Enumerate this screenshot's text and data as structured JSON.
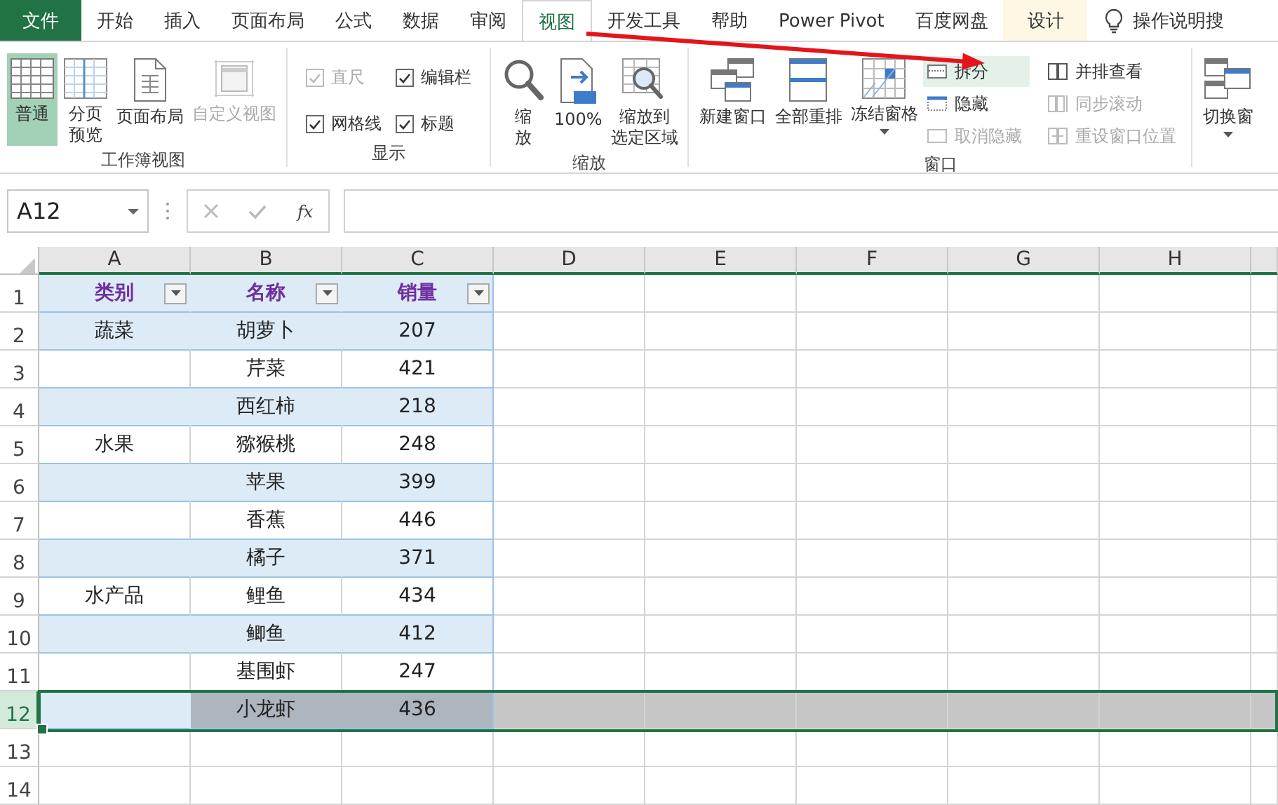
{
  "ribbon_tabs": [
    {
      "label": "文件",
      "kind": "file",
      "selected": false
    },
    {
      "label": "开始",
      "kind": "tab",
      "selected": false
    },
    {
      "label": "插入",
      "kind": "tab",
      "selected": false
    },
    {
      "label": "页面布局",
      "kind": "tab",
      "selected": false
    },
    {
      "label": "公式",
      "kind": "tab",
      "selected": false
    },
    {
      "label": "数据",
      "kind": "tab",
      "selected": false
    },
    {
      "label": "审阅",
      "kind": "tab",
      "selected": false
    },
    {
      "label": "视图",
      "kind": "tab",
      "selected": true
    },
    {
      "label": "开发工具",
      "kind": "tab",
      "selected": false
    },
    {
      "label": "帮助",
      "kind": "tab",
      "selected": false
    },
    {
      "label": "Power Pivot",
      "kind": "tab",
      "selected": false
    },
    {
      "label": "百度网盘",
      "kind": "tab",
      "selected": false
    },
    {
      "label": "设计",
      "kind": "context",
      "selected": false
    }
  ],
  "tell_me": {
    "label": "操作说明搜"
  },
  "ribbon_groups": [
    {
      "title": "工作簿视图",
      "items": [
        {
          "kind": "large",
          "lines": [
            "普通"
          ],
          "selected": true,
          "disabled": false
        },
        {
          "kind": "large",
          "lines": [
            "分页",
            "预览"
          ],
          "selected": false,
          "disabled": false
        },
        {
          "kind": "large",
          "lines": [
            "页面布局"
          ],
          "selected": false,
          "disabled": false
        },
        {
          "kind": "large",
          "lines": [
            "自定义视图"
          ],
          "selected": false,
          "disabled": true
        }
      ]
    },
    {
      "title": "显示",
      "items": [
        {
          "kind": "check",
          "label": "直尺",
          "checked": true,
          "disabled": true
        },
        {
          "kind": "check",
          "label": "编辑栏",
          "checked": true,
          "disabled": false
        },
        {
          "kind": "check",
          "label": "网格线",
          "checked": true,
          "disabled": false
        },
        {
          "kind": "check",
          "label": "标题",
          "checked": true,
          "disabled": false
        }
      ]
    },
    {
      "title": "缩放",
      "items": [
        {
          "kind": "large",
          "lines": [
            "缩",
            "放"
          ],
          "selected": false,
          "disabled": false
        },
        {
          "kind": "large",
          "lines": [
            "100%"
          ],
          "selected": false,
          "disabled": false
        },
        {
          "kind": "large",
          "lines": [
            "缩放到",
            "选定区域"
          ],
          "selected": false,
          "disabled": false
        }
      ]
    },
    {
      "title": "窗口",
      "items": [
        {
          "kind": "large",
          "lines": [
            "新建窗口"
          ],
          "selected": false,
          "disabled": false
        },
        {
          "kind": "large",
          "lines": [
            "全部重排"
          ],
          "selected": false,
          "disabled": false
        },
        {
          "kind": "large",
          "lines": [
            "冻结窗格"
          ],
          "selected": false,
          "disabled": false,
          "dropdown": true
        },
        {
          "kind": "small",
          "label": "拆分",
          "selected": true,
          "disabled": false
        },
        {
          "kind": "small",
          "label": "隐藏",
          "selected": false,
          "disabled": false
        },
        {
          "kind": "small",
          "label": "取消隐藏",
          "selected": false,
          "disabled": true
        },
        {
          "kind": "small",
          "label": "并排查看",
          "selected": false,
          "disabled": false
        },
        {
          "kind": "small",
          "label": "同步滚动",
          "selected": false,
          "disabled": true
        },
        {
          "kind": "small",
          "label": "重设窗口位置",
          "selected": false,
          "disabled": true
        }
      ]
    },
    {
      "items": [
        {
          "kind": "large",
          "lines": [
            "切换窗"
          ],
          "selected": false,
          "disabled": false,
          "dropdown": true
        }
      ]
    }
  ],
  "formula_bar": {
    "name_box": "A12",
    "function_label": "fx"
  },
  "column_headers": [
    "A",
    "B",
    "C",
    "D",
    "E",
    "F",
    "G",
    "H"
  ],
  "row_headers": [
    "1",
    "2",
    "3",
    "4",
    "5",
    "6",
    "7",
    "8",
    "9",
    "10",
    "11",
    "12",
    "13",
    "14"
  ],
  "table": {
    "columns": [
      "类别",
      "名称",
      "销量"
    ],
    "rows": [
      {
        "category": "蔬菜",
        "name": "胡萝卜",
        "sales": "207",
        "selected": false
      },
      {
        "name": "芹菜",
        "sales": "421",
        "selected": false
      },
      {
        "name": "西红柿",
        "sales": "218",
        "selected": false
      },
      {
        "category": "水果",
        "name": "猕猴桃",
        "sales": "248",
        "selected": false
      },
      {
        "name": "苹果",
        "sales": "399",
        "selected": false
      },
      {
        "name": "香蕉",
        "sales": "446",
        "selected": false
      },
      {
        "name": "橘子",
        "sales": "371",
        "selected": false
      },
      {
        "category": "水产品",
        "name": "鲤鱼",
        "sales": "434",
        "selected": false
      },
      {
        "name": "鲫鱼",
        "sales": "412",
        "selected": false
      },
      {
        "name": "基围虾",
        "sales": "247",
        "selected": false
      },
      {
        "name": "小龙虾",
        "sales": "436",
        "selected": true
      }
    ]
  }
}
